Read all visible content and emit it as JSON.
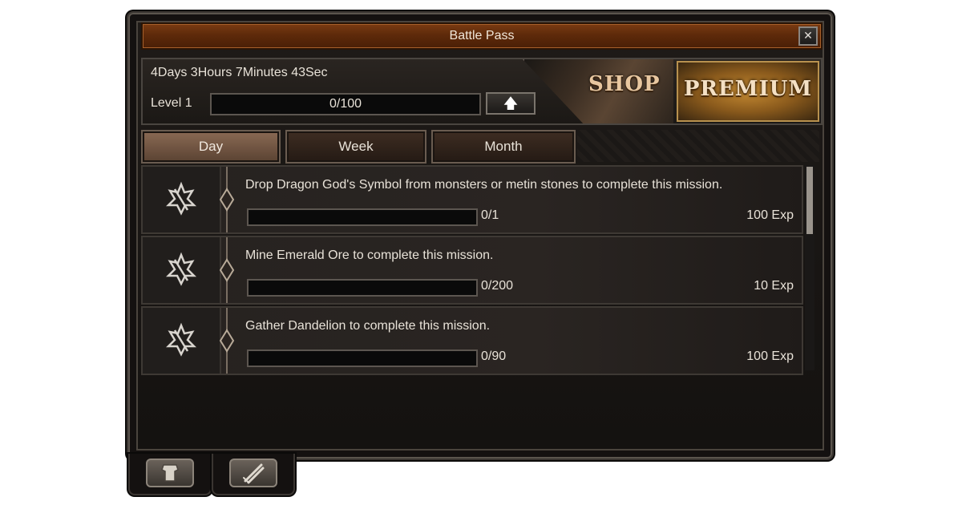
{
  "window": {
    "title": "Battle Pass",
    "close_icon": "close-icon"
  },
  "header": {
    "timer": "4Days 3Hours 7Minutes 43Sec",
    "level_label": "Level 1",
    "level_progress": "0/100",
    "level_progress_fraction": 0.0,
    "shop_label": "SHOP",
    "premium_label": "PREMIUM"
  },
  "tabs": [
    {
      "label": "Day",
      "active": true
    },
    {
      "label": "Week",
      "active": false
    },
    {
      "label": "Month",
      "active": false
    }
  ],
  "missions": [
    {
      "description": "Drop Dragon God's Symbol from monsters or metin stones to complete this mission.",
      "progress": "0/1",
      "reward": "100 Exp",
      "icon": "mission-emblem-icon"
    },
    {
      "description": "Mine Emerald Ore to complete this mission.",
      "progress": "0/200",
      "reward": "10 Exp",
      "icon": "mission-emblem-icon"
    },
    {
      "description": "Gather Dandelion to complete this mission.",
      "progress": "0/90",
      "reward": "100 Exp",
      "icon": "mission-emblem-icon"
    }
  ],
  "bottom_tabs": [
    {
      "icon": "armor-icon"
    },
    {
      "icon": "crossed-swords-icon"
    }
  ],
  "colors": {
    "title_bar": "#5e2a0a",
    "premium_gold": "#c58a32",
    "text": "#e8e2d8"
  }
}
